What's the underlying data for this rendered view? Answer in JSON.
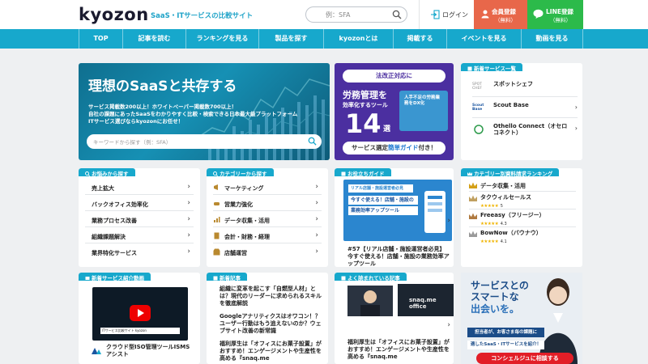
{
  "header": {
    "logo": "kyozon",
    "tagline": "SaaS・ITサービスの比較サイト",
    "search_placeholder": "例：SFA",
    "login": "ログイン",
    "register_line1": "会員登録",
    "register_line2": "（無料）",
    "line_line1": "LINE登録",
    "line_line2": "（無料）"
  },
  "nav": [
    "TOP",
    "記事を読む",
    "ランキングを見る",
    "製品を探す",
    "kyozonとは",
    "掲載する",
    "イベントを見る",
    "動画を見る"
  ],
  "hero": {
    "title": "理想のSaaSと共存する",
    "sub1": "サービス掲載数200以上！ホワイトペーパー掲載数700以上！",
    "sub2": "自社の課題にあったSaaSをわかりやすく比較・検索できる日本最大級プラットフォーム",
    "sub3": "ITサービス選びならkyozonにお任せ！",
    "search_placeholder": "キーワードから探す（例：SFA）"
  },
  "promo": {
    "band": "法改正対応に",
    "t1": "労務管理を",
    "t2": "効率化するツール",
    "num": "14",
    "unit": "選",
    "card": "人手不足の労務業務をDX化",
    "btn_pre": "サービス選定",
    "btn_hl": "簡単ガイド",
    "btn_post": "付き！"
  },
  "new_services": {
    "header": "新着サービス一覧",
    "items": [
      {
        "logo": "SPOT CHEF",
        "name": "スポットシェフ"
      },
      {
        "logo": "Scout Base",
        "name": "Scout Base"
      },
      {
        "logo": "",
        "name": "Othello Connect（オセロコネクト）"
      }
    ]
  },
  "worry": {
    "header": "お悩みから探す",
    "items": [
      "売上拡大",
      "バックオフィス効率化",
      "業務プロセス改善",
      "組織課題解決",
      "業界特化サービス"
    ]
  },
  "category": {
    "header": "カテゴリーから探す",
    "items": [
      "マーケティング",
      "営業力強化",
      "データ収集・活用",
      "会計・財務・経理",
      "店舗運営"
    ]
  },
  "guide": {
    "header": "お役立ちガイド",
    "img_b1": "リアル店舗・施設運営者必見",
    "img_b2": "今すぐ使える！店舗・施設の",
    "img_b3": "業務効率アップツール",
    "title": "#57【リアル店舗・施設運営者必見】今すぐ使える！店舗・施設の業務効率アップツール"
  },
  "ranking": {
    "header": "カテゴリー別資料請求ランキング",
    "category": "データ収集・活用",
    "items": [
      {
        "name": "タクウィルセールス",
        "stars": "★★★★★",
        "rating": "5"
      },
      {
        "name": "Freeasy（フリージー）",
        "stars": "★★★★★",
        "rating": "4.3"
      },
      {
        "name": "BowNow（バウナウ）",
        "stars": "★★★★★",
        "rating": "4.1"
      }
    ]
  },
  "video": {
    "header": "新着サービス紹介動画",
    "caption": "ITサービス比較サイト kyozon",
    "title": "クラウド型ISO管理ツールISMSアシスト"
  },
  "news": {
    "header": "新着記事",
    "items": [
      "組織に変革を起こす「自燃型人材」とは？現代のリーダーに求められるスキルを徹底解説",
      "Googleアナリティクスはオワコン！？ユーザー行動はもう追えないのか？ウェブサイト改善の新常識",
      "福利厚生は「オフィスにお菓子設置」がおすすめ！エンゲージメントや生産性を高める『snaq.me"
    ]
  },
  "popular": {
    "header": "よく読まれている記事",
    "img_text": "snaq.me office",
    "items": [
      "福利厚生は「オフィスにお菓子設置」がおすすめ！エンゲージメントや生産性を高める『snaq.me"
    ]
  },
  "ad": {
    "headline1": "サービスとの",
    "headline2": "スマートな",
    "headline3": "出会いを。",
    "strip1": "担当者が、お客さま毎の課題に",
    "strip2": "適したSaaS・ITサービスを紹介！",
    "cta": "コンシェルジュに相談する"
  },
  "colors": {
    "accent": "#17a8cc",
    "register": "#e8674a",
    "line": "#2cba4a",
    "promo": "#4b2fa0",
    "cta": "#e21e27"
  }
}
